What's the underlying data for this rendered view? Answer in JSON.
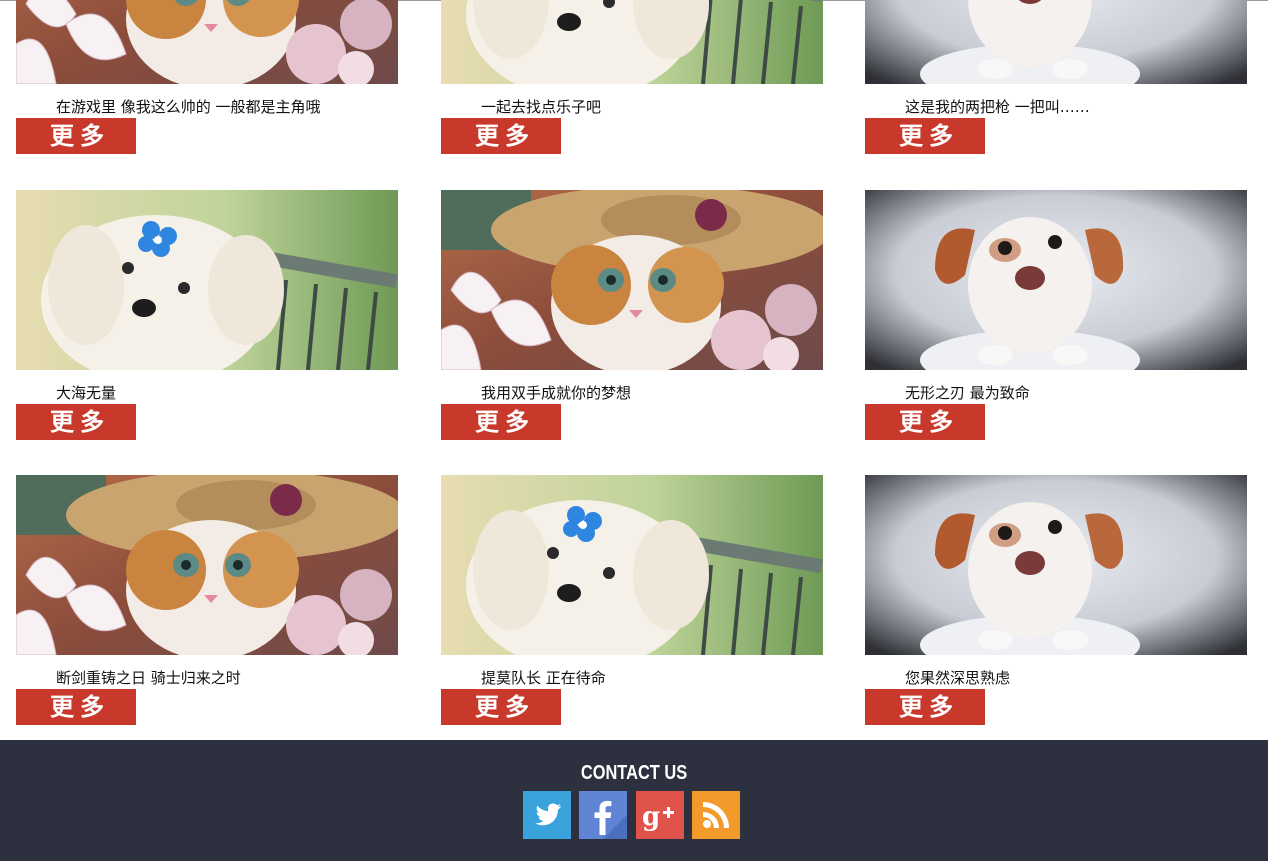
{
  "cards": [
    {
      "caption": "在游戏里 像我这么帅的 一般都是主角哦",
      "more": "更多",
      "image": "kitten-hat"
    },
    {
      "caption": "一起去找点乐子吧",
      "more": "更多",
      "image": "white-puppy"
    },
    {
      "caption": "这是我的两把枪 一把叫……",
      "more": "更多",
      "image": "spotted-dog"
    },
    {
      "caption": "大海无量",
      "more": "更多",
      "image": "white-puppy"
    },
    {
      "caption": "我用双手成就你的梦想",
      "more": "更多",
      "image": "kitten-hat"
    },
    {
      "caption": "无形之刃 最为致命",
      "more": "更多",
      "image": "spotted-dog"
    },
    {
      "caption": "断剑重铸之日 骑士归来之时",
      "more": "更多",
      "image": "kitten-hat"
    },
    {
      "caption": "提莫队长 正在待命",
      "more": "更多",
      "image": "white-puppy"
    },
    {
      "caption": "您果然深思熟虑",
      "more": "更多",
      "image": "spotted-dog"
    }
  ],
  "footer": {
    "title": "CONTACT US",
    "social": [
      {
        "icon": "twitter-icon",
        "color": "#3aa3dc"
      },
      {
        "icon": "facebook-icon",
        "color": "#5f84d4"
      },
      {
        "icon": "google-plus-icon",
        "color": "#e0534a"
      },
      {
        "icon": "rss-icon",
        "color": "#f39a2b"
      }
    ]
  },
  "colors": {
    "accent": "#c8392b",
    "footer_bg": "#2d303f"
  }
}
